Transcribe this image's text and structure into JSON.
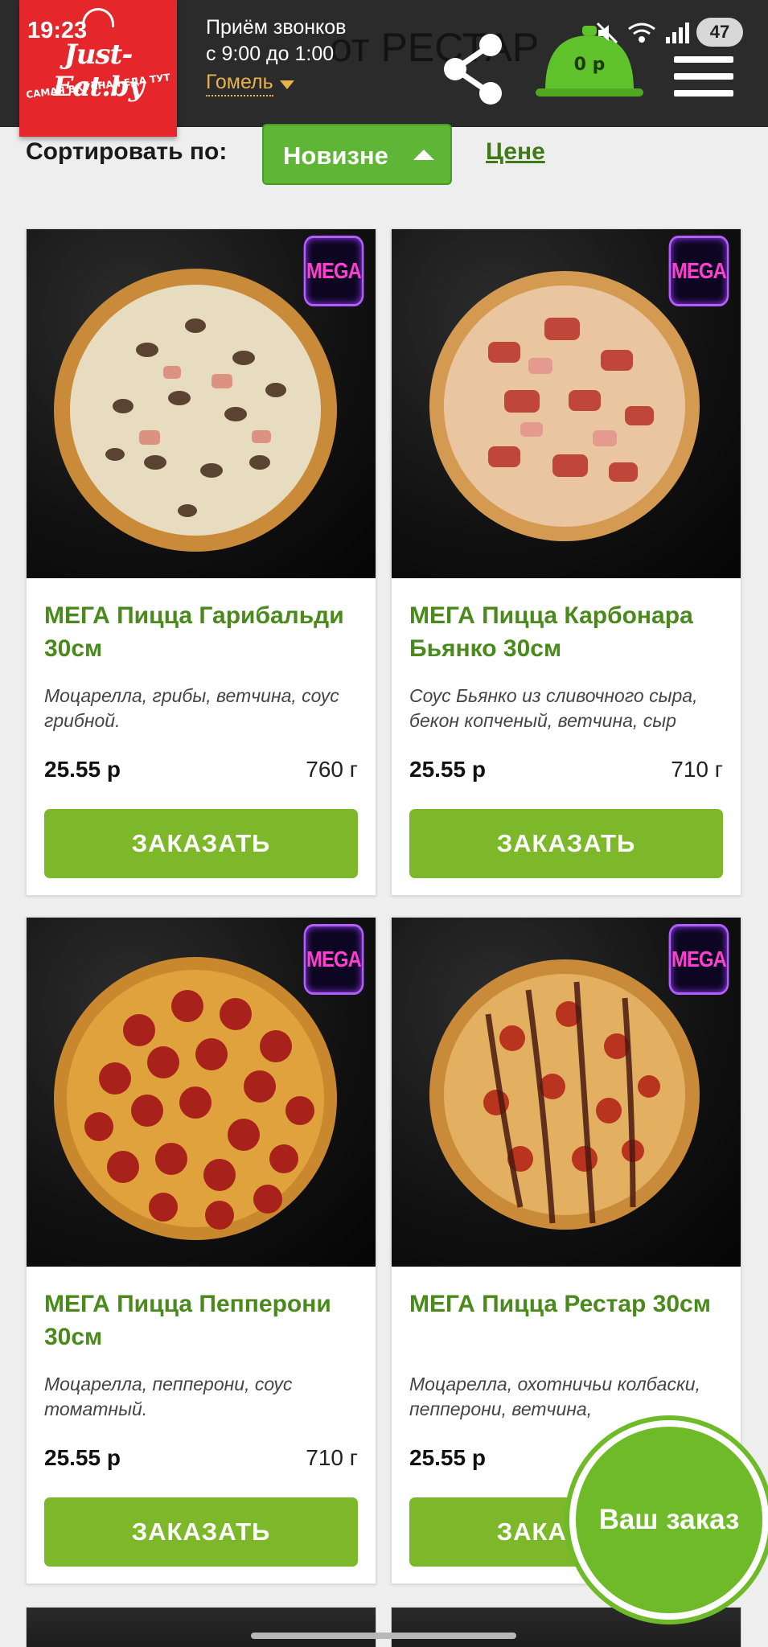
{
  "status_bar": {
    "time": "19:23",
    "battery": "47"
  },
  "header": {
    "logo_text": "Just-Eat.by",
    "logo_tagline": "САМАЯ ВКУСНАЯ ЕДА ТУТ",
    "hours_line1": "Приём звонков",
    "hours_line2": "с 9:00 до 1:00",
    "city": "Гомель",
    "restaurant_title": "от РЕСТАР",
    "cart_total": "0 р"
  },
  "sort": {
    "label": "Сортировать по:",
    "active": "Новизне",
    "alt": "Цене"
  },
  "products": [
    {
      "badge": "MEGA",
      "title": "МЕГА Пицца Гарибальди 30см",
      "desc": "Моцарелла, грибы, ветчина, соус грибной.",
      "price": "25.55 р",
      "weight": "760 г",
      "button": "ЗАКАЗАТЬ"
    },
    {
      "badge": "MEGA",
      "title": "МЕГА Пицца Карбонара Бьянко 30см",
      "desc": "Соус Бьянко из сливочного сыра, бекон копченый, ветчина, сыр",
      "price": "25.55 р",
      "weight": "710 г",
      "button": "ЗАКАЗАТЬ"
    },
    {
      "badge": "MEGA",
      "title": "МЕГА Пицца Пепперони 30см",
      "desc": "Моцарелла, пепперони, соус томатный.",
      "price": "25.55 р",
      "weight": "710 г",
      "button": "ЗАКАЗАТЬ"
    },
    {
      "badge": "MEGA",
      "title": "МЕГА Пицца Рестар 30см",
      "desc": "Моцарелла, охотничьи колбаски, пепперони, ветчина,",
      "price": "25.55 р",
      "weight": "",
      "button": "ЗАКАЗАТЬ"
    }
  ],
  "floating": {
    "your_order": "Ваш заказ"
  },
  "colors": {
    "header_bg": "#2b2b2b",
    "logo_red": "#e5262b",
    "accent_green": "#7cb82a",
    "title_green": "#4a8a1c",
    "city_orange": "#e8b14b",
    "badge_magenta": "#ff3fcf"
  },
  "icons": [
    "share-icon",
    "cart-cloche-icon",
    "menu-icon",
    "mute-icon",
    "wifi-icon",
    "signal-icon",
    "caret-down-icon",
    "caret-up-icon"
  ]
}
